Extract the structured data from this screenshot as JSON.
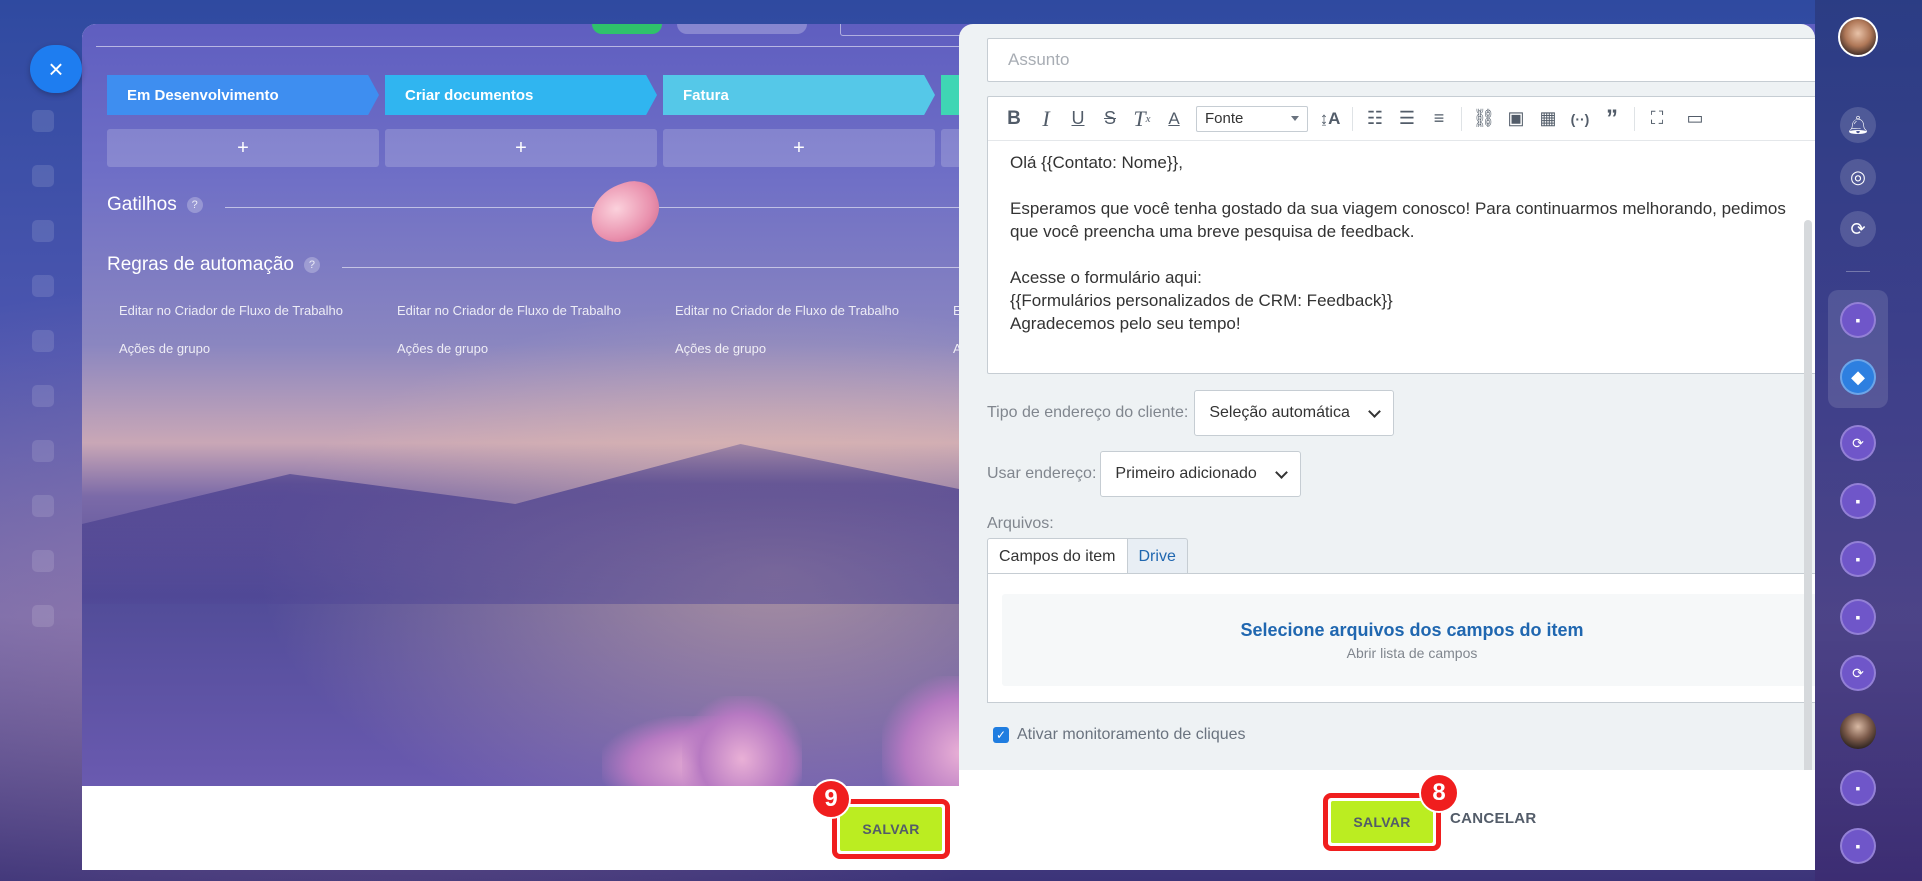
{
  "close_label": "×",
  "left_panel": {
    "stages": [
      {
        "label": "Em Desenvolvimento",
        "color": "#3e8ef0"
      },
      {
        "label": "Criar documentos",
        "color": "#30b5f0"
      },
      {
        "label": "Fatura",
        "color": "#55c8e8"
      },
      {
        "label": "",
        "color": "#3fd6b4"
      }
    ],
    "plus_label": "+",
    "triggers_title": "Gatilhos",
    "rules_title": "Regras de automação",
    "help_glyph": "?",
    "rules_columns": [
      {
        "edit": "Editar no Criador de Fluxo de Trabalho",
        "group": "Ações de grupo"
      },
      {
        "edit": "Editar no Criador de Fluxo de Trabalho",
        "group": "Ações de grupo"
      },
      {
        "edit": "Editar no Criador de Fluxo de Trabalho",
        "group": "Ações de grupo"
      },
      {
        "edit": "E",
        "group": "A"
      }
    ],
    "save_label": "SALVAR",
    "badge": "9"
  },
  "email_form": {
    "subject_placeholder": "Assunto",
    "font_select": "Fonte",
    "body_lines": [
      "Olá {{Contato: Nome}},",
      "",
      "Esperamos que você tenha gostado da sua viagem conosco! Para continuarmos melhorando, pedimos",
      "que você preencha uma breve pesquisa de feedback.",
      "",
      "Acesse o formulário aqui:",
      "{{Formulários personalizados de CRM: Feedback}}",
      "Agradecemos pelo seu tempo!"
    ],
    "address_type_label": "Tipo de endereço do cliente:",
    "address_type_value": "Seleção automática",
    "use_address_label": "Usar endereço:",
    "use_address_value": "Primeiro adicionado",
    "files_label": "Arquivos:",
    "tabs": [
      "Campos do item",
      "Drive"
    ],
    "files_title": "Selecione arquivos dos campos do item",
    "files_subtitle": "Abrir lista de campos",
    "checkbox_label": "Ativar monitoramento de cliques",
    "checkbox_checked": true,
    "save_label": "SALVAR",
    "cancel_label": "CANCELAR",
    "badge": "8"
  },
  "toolbar_icons": [
    "bold-icon",
    "italic-icon",
    "underline-icon",
    "strikethrough-icon",
    "clear-format-icon",
    "text-color-icon",
    "font-size-icon",
    "numbered-list-icon",
    "bullet-list-icon",
    "align-icon",
    "link-icon",
    "image-icon",
    "table-icon",
    "code-icon",
    "quote-icon",
    "fullscreen-icon",
    "source-icon"
  ],
  "accent_colors": {
    "highlight": "#f01e1e",
    "save": "#bbed21",
    "link": "#2067b0"
  }
}
